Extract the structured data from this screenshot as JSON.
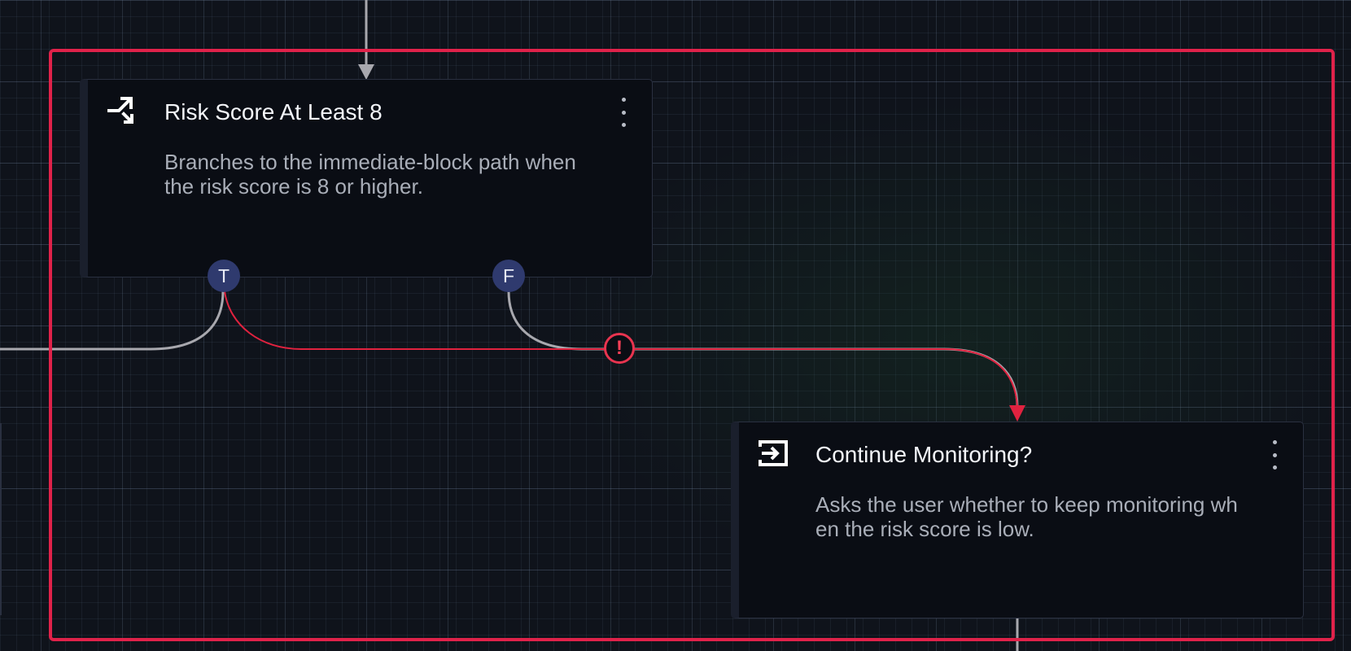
{
  "nodes": {
    "risk_check": {
      "title": "Risk Score At Least 8",
      "description": "Branches to the immediate-block path when the risk score is 8 or higher.",
      "icon": "branch-split-icon",
      "ports": {
        "true_label": "T",
        "false_label": "F"
      }
    },
    "continue_monitoring": {
      "title": "Continue Monitoring?",
      "description": "Asks the user whether to keep monitoring when the risk score is low.",
      "icon": "input-arrow-icon"
    }
  },
  "edge_warning": {
    "symbol": "!"
  },
  "colors": {
    "selection": "#e0224a",
    "edge_default": "#a8a8ae",
    "edge_error": "#e0223f",
    "port_fill": "#2f3a6e",
    "node_fill": "#0a0d14"
  }
}
